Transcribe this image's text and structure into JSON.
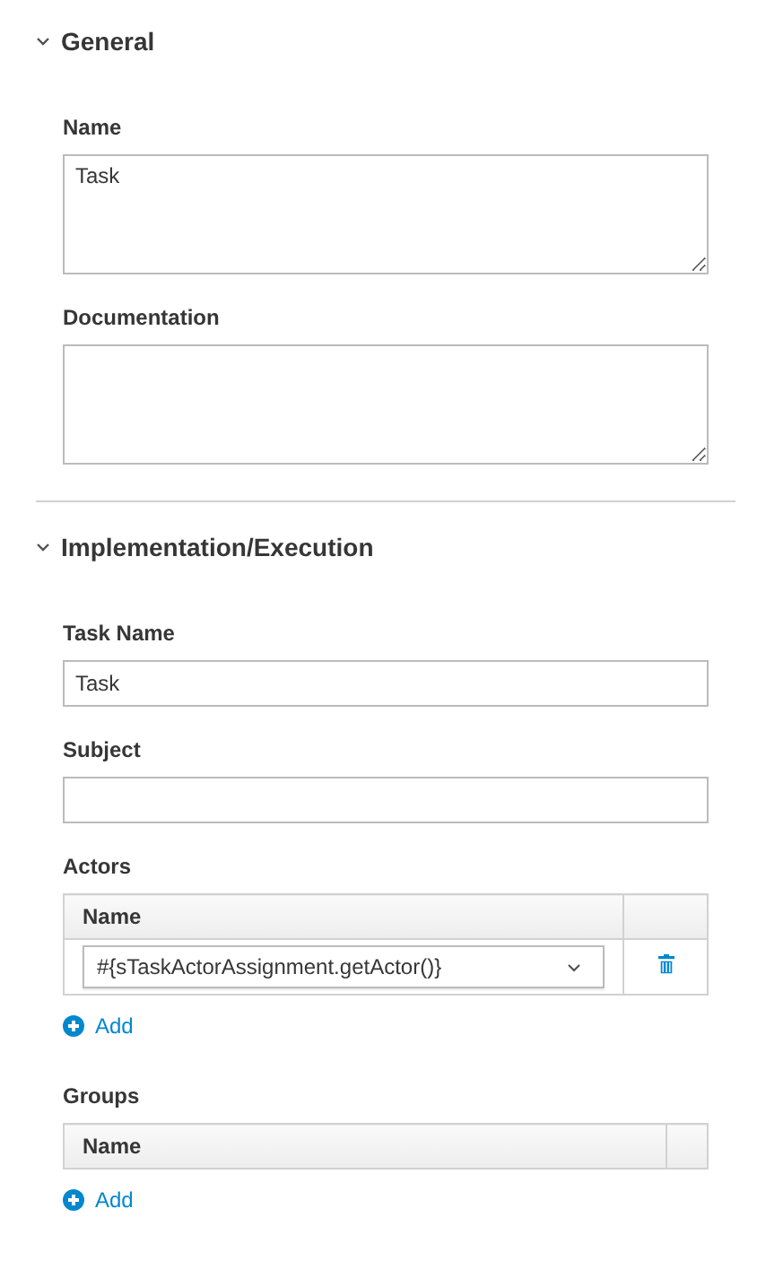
{
  "sections": [
    {
      "title": "General",
      "expanded": true,
      "fields": [
        {
          "kind": "textarea",
          "label": "Name",
          "value": "Task"
        },
        {
          "kind": "textarea",
          "label": "Documentation"
        }
      ]
    },
    {
      "title": "Implementation/Execution",
      "expanded": true,
      "fields": [
        {
          "kind": "text",
          "label": "Task Name",
          "value": "Task"
        },
        {
          "kind": "text",
          "label": "Subject"
        },
        {
          "kind": "table",
          "label": "Actors",
          "column": "Name",
          "rows": [
            {
              "value": "#{sTaskActorAssignment.getActor()}"
            }
          ],
          "add": "Add"
        },
        {
          "kind": "table",
          "label": "Groups",
          "column": "Name",
          "add": "Add"
        }
      ]
    }
  ]
}
